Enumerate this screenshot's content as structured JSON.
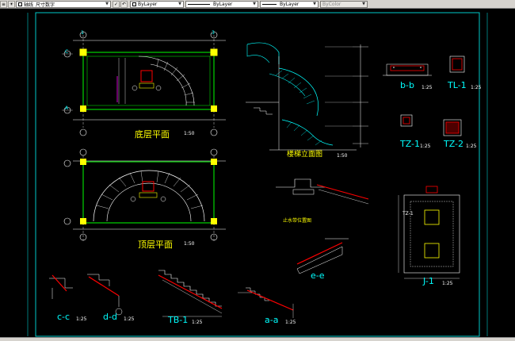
{
  "toolbar": {
    "layer_name": "轴线_尺寸数字",
    "linetype_label": "ByLayer",
    "lineweight_label": "ByLayer",
    "plotstyle_label": "ByLayer",
    "color_label": "ByColor",
    "linetype2_label": "ByLayer"
  },
  "drawing": {
    "plan1_title": "底层平面",
    "plan1_scale": "1:50",
    "plan2_title": "顶层平面",
    "plan2_scale": "1:50",
    "stair_section_title": "楼梯立面图",
    "stair_section_scale": "1:50",
    "waterproof_title": "止水带位置图",
    "bb_title": "b-b",
    "bb_scale": "1:25",
    "tl1_title": "TL-1",
    "tl1_scale": "1:25",
    "tz1_title": "TZ-1",
    "tz1_scale": "1:25",
    "tz2_title": "TZ-2",
    "tz2_scale": "1:25",
    "ee_title": "e-e",
    "j1_title": "J-1",
    "j1_scale": "1:25",
    "tz1_tag": "TZ-1",
    "cc_title": "c-c",
    "cc_scale": "1:25",
    "dd_title": "d-d",
    "dd_scale": "1:25",
    "tb1_title": "TB-1",
    "tb1_scale": "1:25",
    "aa_title": "a-a",
    "aa_scale": "1:25",
    "axis_1": "1",
    "axis_3": "3",
    "axis_C": "C",
    "axis_A": "A"
  },
  "colors": {
    "frame": "#00c8c8",
    "wall": "#00ff00",
    "line": "#ffffff",
    "accent": "#ff0000",
    "title": "#ffff00",
    "stair": "#00ffff"
  }
}
